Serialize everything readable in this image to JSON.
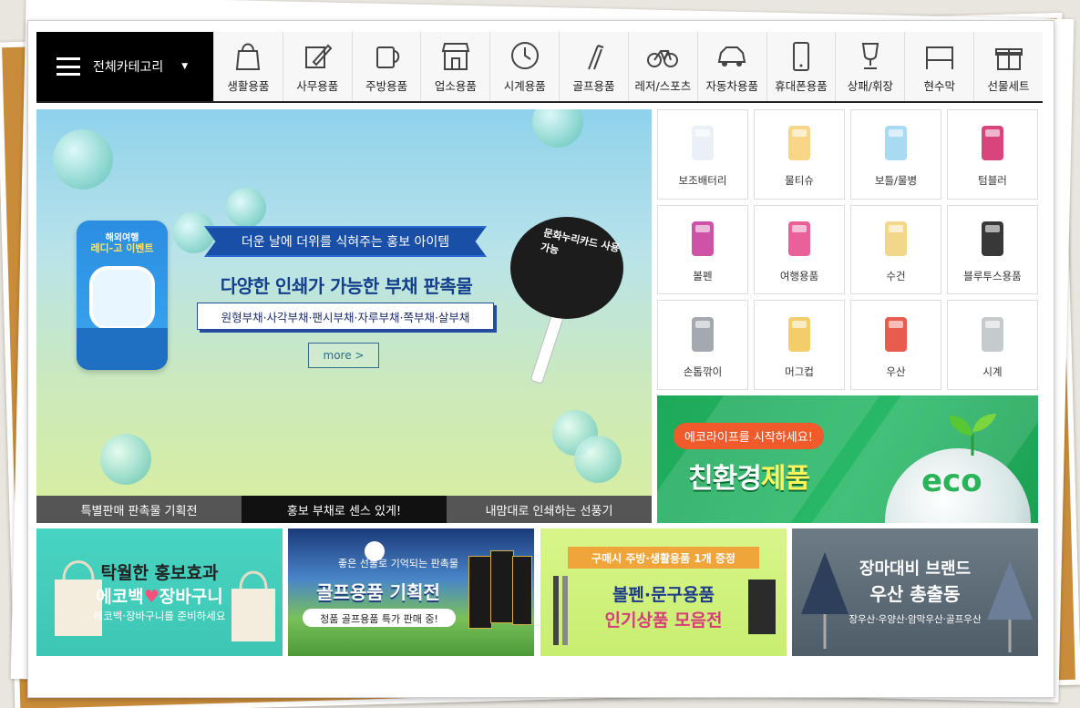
{
  "nav": {
    "all_categories": "전체카테고리",
    "categories": [
      {
        "label": "생활용품",
        "icon": "shopping-bag-icon"
      },
      {
        "label": "사무용품",
        "icon": "pencil-note-icon"
      },
      {
        "label": "주방용품",
        "icon": "mug-icon"
      },
      {
        "label": "업소용품",
        "icon": "storefront-icon"
      },
      {
        "label": "시계용품",
        "icon": "clock-icon"
      },
      {
        "label": "골프용품",
        "icon": "golf-clubs-icon"
      },
      {
        "label": "레저/스포츠",
        "icon": "bicycle-icon"
      },
      {
        "label": "자동차용품",
        "icon": "car-icon"
      },
      {
        "label": "휴대폰용품",
        "icon": "phone-icon"
      },
      {
        "label": "상패/휘장",
        "icon": "trophy-icon"
      },
      {
        "label": "현수막",
        "icon": "banner-icon"
      },
      {
        "label": "선물세트",
        "icon": "gift-icon"
      }
    ]
  },
  "hero": {
    "tag": "더운 날에 더위를 식혀주는 홍보 아이템",
    "title": "다양한 인쇄가 가능한 부채 판촉물",
    "subtitle": "원형부채·사각부채·팬시부채·자루부채·쪽부채·살부채",
    "more": "more >",
    "card_line1": "해외여행",
    "card_line2": "레디-고 이벤트",
    "fan_text": "문화누리카드 사용가능",
    "tabs": [
      "특별판매 판촉물 기획전",
      "홍보 부채로 센스 있게!",
      "내맘대로 인쇄하는 선풍기"
    ],
    "active_tab": 1
  },
  "products": [
    {
      "label": "보조배터리",
      "color": "#e8eef5"
    },
    {
      "label": "물티슈",
      "color": "#f6d27a"
    },
    {
      "label": "보틀/물병",
      "color": "#9fd6f0"
    },
    {
      "label": "텀블러",
      "color": "#d6306f"
    },
    {
      "label": "볼펜",
      "color": "#c93f9b"
    },
    {
      "label": "여행용품",
      "color": "#e84f8e"
    },
    {
      "label": "수건",
      "color": "#f1d27c"
    },
    {
      "label": "블루투스용품",
      "color": "#222222"
    },
    {
      "label": "손톱깎이",
      "color": "#9aa0a6"
    },
    {
      "label": "머그컵",
      "color": "#f2c85a"
    },
    {
      "label": "우산",
      "color": "#e64a3b"
    },
    {
      "label": "시계",
      "color": "#bfc4c8"
    }
  ],
  "eco": {
    "pill": "에코라이프를 시작하세요!",
    "title_a": "친환경",
    "title_b": "제품",
    "globe_text": "eco"
  },
  "banners": [
    {
      "line1": "탁월한 홍보효과",
      "line2a": "에코백",
      "line2b": "장바구니",
      "line3": "에코백·장바구니를 준비하세요"
    },
    {
      "line1": "좋은 선물로 기억되는 판촉물",
      "line2": "골프용품 기획전",
      "line3": "정품 골프용품 특가 판매 중!"
    },
    {
      "line1": "구매시 주방·생활용품 1개 증정",
      "line2": "볼펜·문구용품",
      "line3": "인기상품 모음전"
    },
    {
      "line1": "장마대비 브랜드",
      "line2": "우산 총출동",
      "line3": "장우산·우양산·암막우산·골프우산"
    }
  ]
}
